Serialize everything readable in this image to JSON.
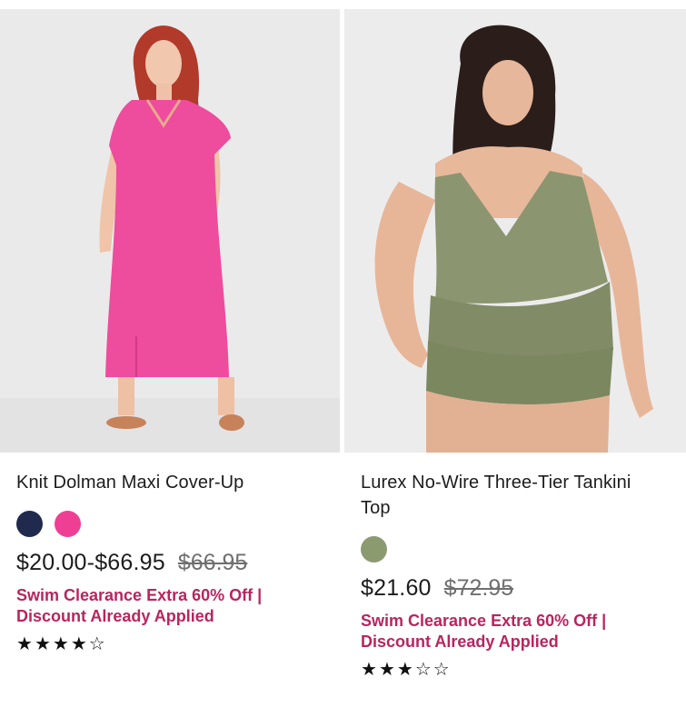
{
  "products": [
    {
      "name": "Knit Dolman Maxi Cover-Up",
      "swatches": [
        {
          "color_name": "navy",
          "hex": "#1f2a4d"
        },
        {
          "color_name": "pink",
          "hex": "#ef3f95"
        }
      ],
      "price": "$20.00-$66.95",
      "original_price": "$66.95",
      "promo": "Swim Clearance Extra 60% Off | Discount Already Applied",
      "promo_color": "#b8255f",
      "rating": 4,
      "rating_max": 5,
      "stars": {
        "s1": "★",
        "s2": "★",
        "s3": "★",
        "s4": "★",
        "s5": "☆"
      }
    },
    {
      "name": "Lurex No-Wire Three-Tier Tankini Top",
      "swatches": [
        {
          "color_name": "olive",
          "hex": "#8c9a70"
        }
      ],
      "price": "$21.60",
      "original_price": "$72.95",
      "promo": "Swim Clearance Extra 60% Off | Discount Already Applied",
      "promo_color": "#b8255f",
      "rating": 3,
      "rating_max": 5,
      "stars": {
        "s1": "★",
        "s2": "★",
        "s3": "★",
        "s4": "☆",
        "s5": "☆"
      }
    }
  ]
}
